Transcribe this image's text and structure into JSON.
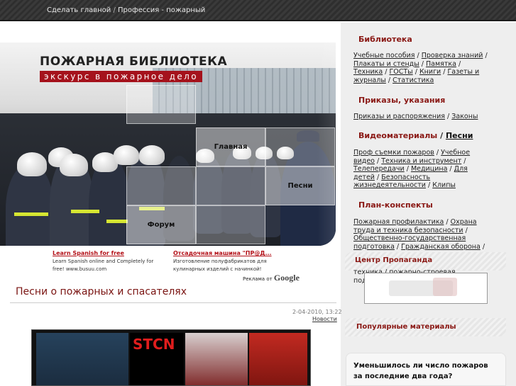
{
  "topbar": {
    "home_link": "Сделать главной",
    "separator": " / ",
    "page_link": "Профессия - пожарный"
  },
  "header": {
    "title": "ПОЖАРНАЯ БИБЛИОТЕКА",
    "subtitle": "экскурс в пожарное дело"
  },
  "hero_nav": {
    "home": "Главная",
    "songs": "Песни",
    "forum": "Форум"
  },
  "ads": [
    {
      "title": "Learn Spanish for free",
      "text": "Learn Spanish online and Completely for free! www.busuu.com"
    },
    {
      "title": "Отсадочная машина \"ПР@Д...",
      "text": "Изготовление полуфабрикатов для кулинарных изделий с начинкой!"
    }
  ],
  "ads_by": {
    "label": "Реклама от",
    "brand": "Google"
  },
  "article": {
    "title": "Песни о пожарных и спасателях",
    "date": "2-04-2010, 13:22",
    "category": "Новости",
    "image_label": "STCN"
  },
  "sidebar": {
    "library": {
      "title": "Библиотека",
      "links": [
        "Учебные пособия",
        "Проверка знаний",
        "Плакаты и стенды",
        "Памятка",
        "Техника",
        "ГОСТы",
        "Книги",
        "Газеты и журналы",
        "Статистика"
      ]
    },
    "orders": {
      "title": "Приказы, указания",
      "links": [
        "Приказы и распоряжения",
        "Законы"
      ]
    },
    "video": {
      "title": "Видеоматериалы",
      "title_link": "Песни",
      "links": [
        "Проф съемки пожаров",
        "Учебное видео",
        "Техника и инструмент",
        "Телепередачи",
        "Медицина",
        "Для детей",
        "Безопасность жизнедеятельности",
        "Клипы"
      ]
    },
    "plans": {
      "title": "План-конспекты",
      "links": [
        "Пожарная профилактика",
        "Охрана труда и техника безопасности",
        "Общественно-государственная подготовка",
        "Гражданская оборона"
      ]
    },
    "propaganda": {
      "title": "Центр Пропаганда",
      "partial_text": "техника / пожарно-строевая подготовка / ...а /"
    },
    "popular": {
      "title": "Популярные материалы"
    },
    "poll": {
      "question": "Уменьшилось ли число пожаров за последние два года?"
    }
  },
  "colors": {
    "accent": "#8a1814",
    "brand_red": "#a5121c",
    "topbar": "#333333"
  }
}
